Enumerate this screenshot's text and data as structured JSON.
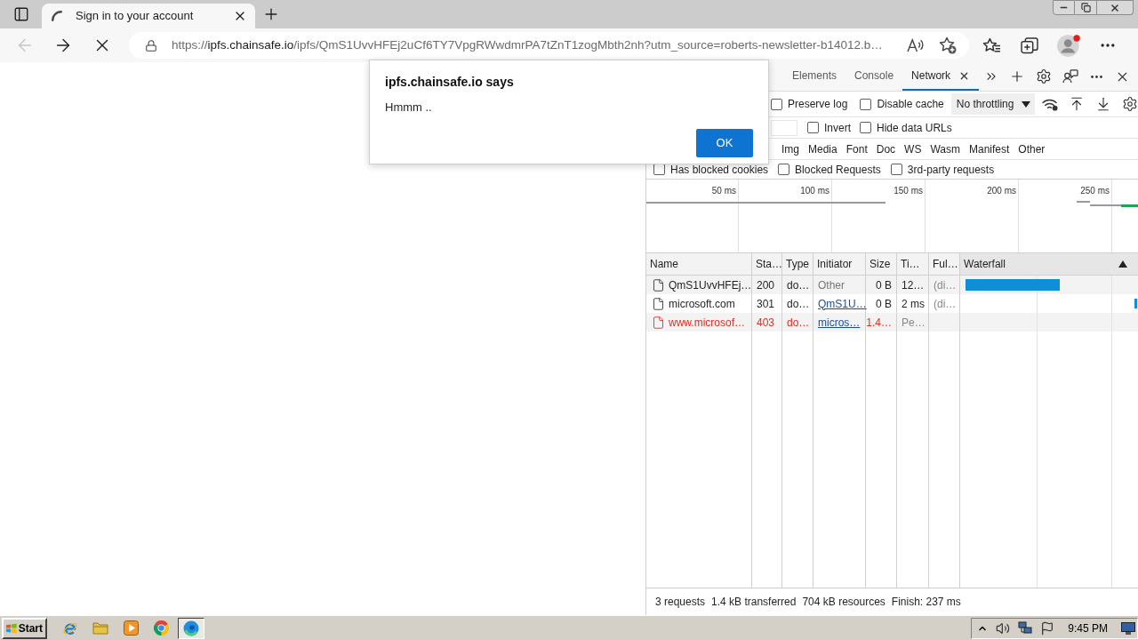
{
  "browser": {
    "tabs": [
      {
        "title": "Sign in to your account",
        "selected": true,
        "loading": true
      }
    ],
    "back": {
      "disabled": true
    },
    "address_bar": {
      "scheme": "https://",
      "host": "ipfs.chainsafe.io",
      "path": "/ipfs/QmS1UvvHFEj2uCf6TY7VpgRWwdmrPA7tZnT1zogMbth2nh?utm_source=roberts-newsletter-b14012.b…"
    },
    "profile": {
      "notification": true
    }
  },
  "dialog": {
    "title": "ipfs.chainsafe.io says",
    "message": "Hmmm ..",
    "button": "OK"
  },
  "devtools": {
    "tabs": [
      {
        "label": "Elements",
        "selected": false
      },
      {
        "label": "Console",
        "selected": false
      },
      {
        "label": "Network",
        "selected": true
      }
    ],
    "toolbar": {
      "checkboxes": [
        {
          "label": "Preserve log",
          "checked": false
        },
        {
          "label": "Disable cache",
          "checked": false
        }
      ],
      "throttling": "No throttling"
    },
    "filter_bar": {
      "checkboxes": [
        {
          "label": "Invert",
          "checked": false
        },
        {
          "label": "Hide data URLs",
          "checked": false
        }
      ]
    },
    "resource_types": [
      {
        "label": "Img",
        "selected": false
      },
      {
        "label": "Media",
        "selected": false
      },
      {
        "label": "Font",
        "selected": false
      },
      {
        "label": "Doc",
        "selected": false
      },
      {
        "label": "WS",
        "selected": false
      },
      {
        "label": "Wasm",
        "selected": false
      },
      {
        "label": "Manifest",
        "selected": false
      },
      {
        "label": "Other",
        "selected": false
      }
    ],
    "request_filters": [
      {
        "label": "Has blocked cookies",
        "checked": false
      },
      {
        "label": "Blocked Requests",
        "checked": false
      },
      {
        "label": "3rd-party requests",
        "checked": false
      }
    ],
    "overview": {
      "ticks": [
        "50 ms",
        "100 ms",
        "150 ms",
        "200 ms",
        "250 ms"
      ]
    },
    "table": {
      "columns": [
        {
          "label": "Name",
          "sorted_ascending": false
        },
        {
          "label": "Sta…",
          "sorted_ascending": false
        },
        {
          "label": "Type",
          "sorted_ascending": false
        },
        {
          "label": "Initiator",
          "sorted_ascending": false
        },
        {
          "label": "Size",
          "sorted_ascending": false
        },
        {
          "label": "Ti…",
          "sorted_ascending": false
        },
        {
          "label": "Ful…",
          "sorted_ascending": false
        },
        {
          "label": "Waterfall",
          "sorted_ascending": true
        }
      ],
      "rows": [
        {
          "cells": [
            "QmS1UvvHFEj…",
            "200",
            "do…",
            "Other",
            "0 B",
            "12…",
            "(di…"
          ],
          "initiator_link": false,
          "error": false,
          "waterfall_bar": true,
          "waterfall_tick": false
        },
        {
          "cells": [
            "microsoft.com",
            "301",
            "do…",
            "QmS1U…",
            "0 B",
            "2 ms",
            "(di…"
          ],
          "initiator_link": true,
          "error": false,
          "waterfall_bar": false,
          "waterfall_tick": true
        },
        {
          "cells": [
            "www.microsof…",
            "403",
            "do…",
            "micros…",
            "1.4…",
            "Pe…"
          ],
          "initiator_link": true,
          "error": true,
          "waterfall_bar": false,
          "waterfall_tick": false
        }
      ]
    },
    "status_bar": [
      "3 requests",
      "1.4 kB transferred",
      "704 kB resources",
      "Finish: 237 ms"
    ]
  },
  "taskbar": {
    "start": "Start",
    "apps": [
      {
        "kind": "ie",
        "selected": false
      },
      {
        "kind": "folder",
        "selected": false
      },
      {
        "kind": "media",
        "selected": false
      },
      {
        "kind": "chrome",
        "selected": false
      },
      {
        "kind": "edge",
        "selected": true
      }
    ],
    "clock": "9:45 PM"
  }
}
